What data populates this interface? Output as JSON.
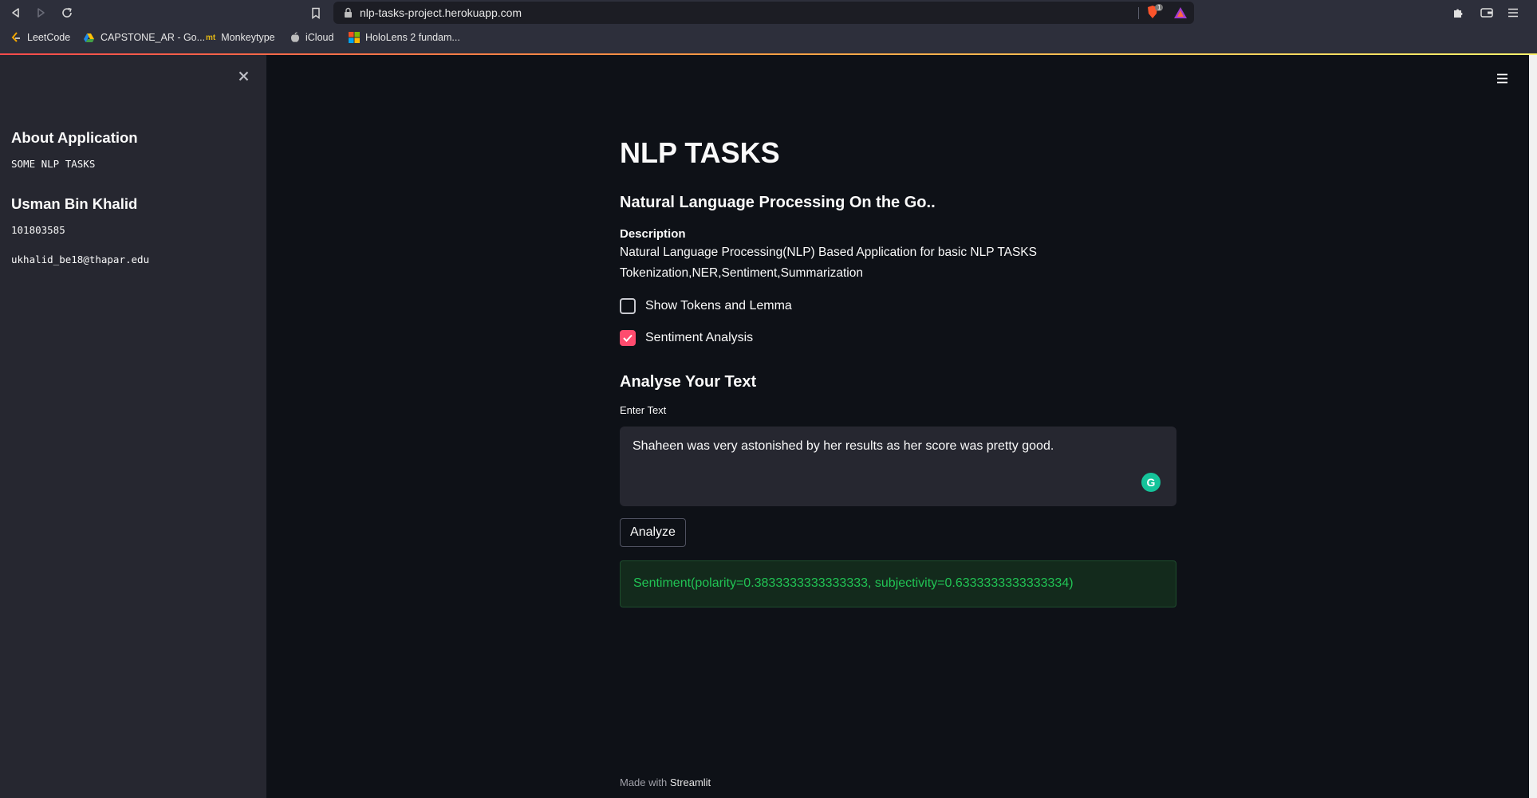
{
  "browser": {
    "url": "nlp-tasks-project.herokuapp.com",
    "shield_count": "1",
    "bookmarks": [
      {
        "label": "LeetCode",
        "icon": "leetcode-icon"
      },
      {
        "label": "CAPSTONE_AR - Go...",
        "icon": "google-drive-icon"
      },
      {
        "label": "Monkeytype",
        "icon": "monkeytype-icon"
      },
      {
        "label": "iCloud",
        "icon": "apple-icon"
      },
      {
        "label": "HoloLens 2 fundam...",
        "icon": "microsoft-icon"
      }
    ]
  },
  "sidebar": {
    "about_heading": "About Application",
    "about_text": "SOME NLP TASKS",
    "author_name": "Usman Bin Khalid",
    "author_id": "101803585",
    "author_email": "ukhalid_be18@thapar.edu"
  },
  "main": {
    "title": "NLP TASKS",
    "subtitle": "Natural Language Processing On the Go..",
    "description_heading": "Description",
    "description_line1": "Natural Language Processing(NLP) Based Application for basic NLP TASKS",
    "description_line2": "Tokenization,NER,Sentiment,Summarization",
    "checkboxes": [
      {
        "label": "Show Tokens and Lemma",
        "checked": false
      },
      {
        "label": "Sentiment Analysis",
        "checked": true
      }
    ],
    "analyse_heading": "Analyse Your Text",
    "input_label": "Enter Text",
    "input_value": "Shaheen was very astonished by her results as her score was pretty good.",
    "grammarly_glyph": "G",
    "analyze_button": "Analyze",
    "result": "Sentiment(polarity=0.3833333333333333, subjectivity=0.6333333333333334)",
    "footer_prefix": "Made with",
    "footer_brand": "Streamlit"
  },
  "colors": {
    "background": "#0e1117",
    "sidebar": "#262730",
    "accent": "#ff4b6e",
    "success_text": "#21c354"
  }
}
